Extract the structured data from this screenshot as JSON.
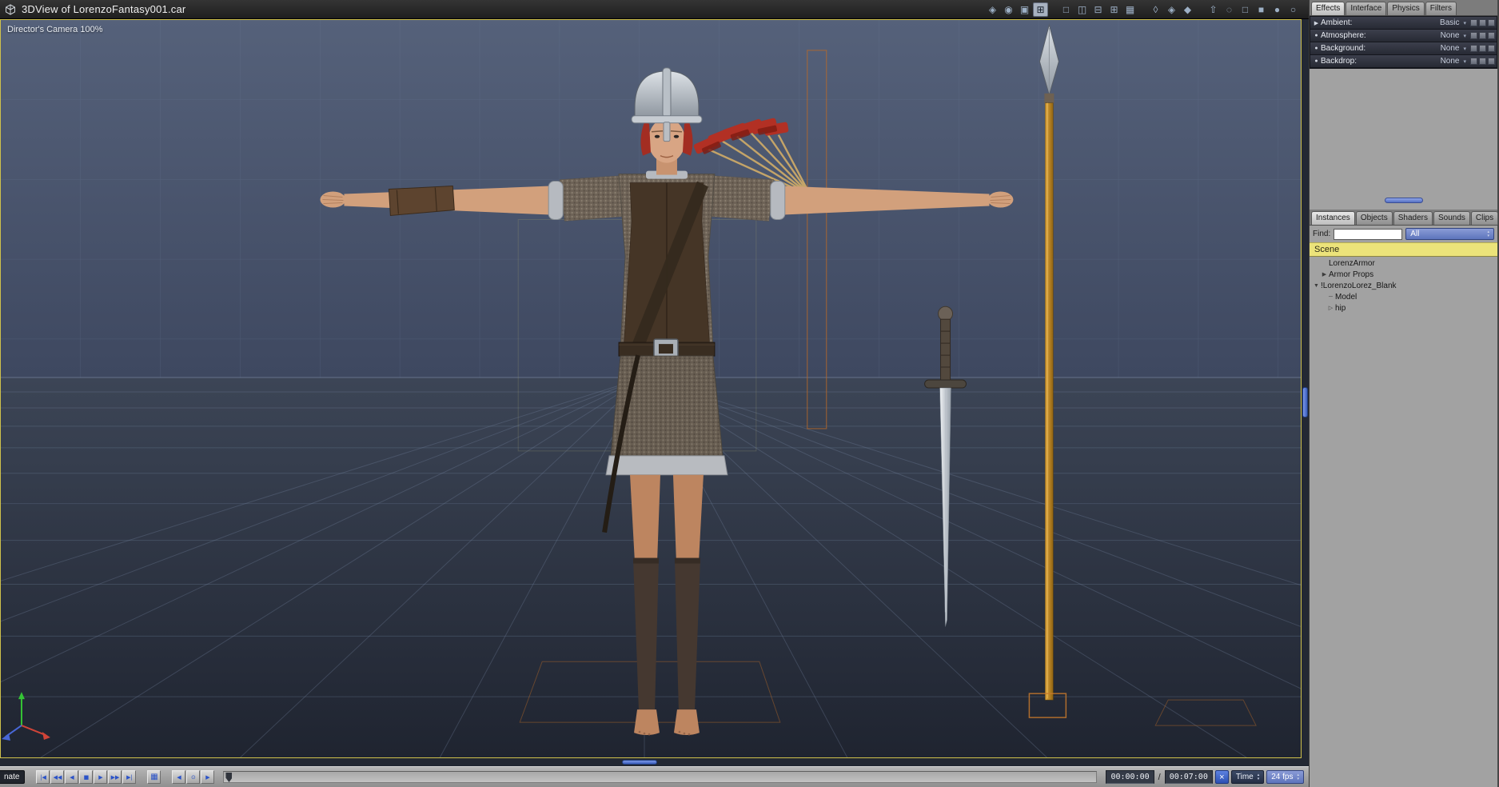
{
  "colors": {
    "accent_blue": "#3a66cc",
    "viewport_background": "#46516a",
    "active_pane_border": "#cfc14b",
    "wireframe_orange": "#b96a28",
    "scene_header_yellow": "#ece37a"
  },
  "window": {
    "title": "3DView of LorenzoFantasy001.car"
  },
  "viewport": {
    "camera_label": "Director's Camera 100%"
  },
  "ui": {
    "chevron_down": "▾",
    "spin_up": "▴",
    "spin_down": "▾"
  },
  "titlebar": {
    "icons": [
      {
        "name": "track-tool-icon",
        "glyph": "◈"
      },
      {
        "name": "eye-icon",
        "glyph": "◉"
      },
      {
        "name": "camera-capture-icon",
        "glyph": "▣"
      },
      {
        "name": "grid-view-icon",
        "glyph": "⊞",
        "cls": "active"
      },
      {
        "name": "layout-single-pane-icon",
        "glyph": "□",
        "cls": "grp"
      },
      {
        "name": "layout-split-vertical-icon",
        "glyph": "◫"
      },
      {
        "name": "layout-split-horizontal-icon",
        "glyph": "⊟"
      },
      {
        "name": "layout-quad-icon",
        "glyph": "⊞"
      },
      {
        "name": "layout-grid-icon",
        "glyph": "▦"
      },
      {
        "name": "shield-low-icon",
        "glyph": "◊",
        "cls": "grp"
      },
      {
        "name": "shield-mid-icon",
        "glyph": "◈"
      },
      {
        "name": "shield-high-icon",
        "glyph": "◆"
      },
      {
        "name": "send-to-icon",
        "glyph": "⇧",
        "cls": "grp"
      },
      {
        "name": "bounding-box-icon",
        "glyph": "◌"
      },
      {
        "name": "wireframe-cube-icon",
        "glyph": "□"
      },
      {
        "name": "solid-cube-icon",
        "glyph": "■"
      },
      {
        "name": "shaded-sphere-icon",
        "glyph": "●"
      },
      {
        "name": "textured-sphere-icon",
        "glyph": "○"
      }
    ]
  },
  "transport": {
    "animate_label": "nate",
    "buttons": [
      {
        "name": "go-to-start-button",
        "glyph": "|◀"
      },
      {
        "name": "rewind-button",
        "glyph": "◀◀"
      },
      {
        "name": "play-reverse-button",
        "glyph": "◀"
      },
      {
        "name": "stop-button",
        "glyph": "■"
      },
      {
        "name": "play-button",
        "glyph": "▶"
      },
      {
        "name": "fast-forward-button",
        "glyph": "▶▶"
      },
      {
        "name": "go-to-end-button",
        "glyph": "▶|"
      }
    ],
    "capture_button": {
      "glyph": "▦"
    },
    "key_buttons": [
      {
        "name": "previous-keyframe-button",
        "glyph": "◀"
      },
      {
        "name": "add-keyframe-button",
        "glyph": "⊙"
      },
      {
        "name": "next-keyframe-button",
        "glyph": "▶"
      }
    ],
    "current_time": "00:00:00",
    "time_separator": "/",
    "end_time": "00:07:00",
    "close_glyph": "×",
    "time_mode_value": "Time",
    "frame_rate_value": "24 fps"
  },
  "effects_panel": {
    "tabs": [
      {
        "name": "tab-effects",
        "label": "Effects",
        "cls": "active"
      },
      {
        "name": "tab-interface",
        "label": "Interface"
      },
      {
        "name": "tab-physics",
        "label": "Physics"
      },
      {
        "name": "tab-filters",
        "label": "Filters"
      }
    ],
    "rows": [
      {
        "name": "property-row-ambient",
        "marker": "▶",
        "label": "Ambient:",
        "value": "Basic"
      },
      {
        "name": "property-row-atmosphere",
        "marker": "●",
        "label": "Atmosphere:",
        "value": "None"
      },
      {
        "name": "property-row-background",
        "marker": "●",
        "label": "Background:",
        "value": "None"
      },
      {
        "name": "property-row-backdrop",
        "marker": "●",
        "label": "Backdrop:",
        "value": "None"
      }
    ]
  },
  "browser_panel": {
    "tabs": [
      {
        "name": "tab-instances",
        "label": "Instances",
        "cls": "active"
      },
      {
        "name": "tab-objects",
        "label": "Objects"
      },
      {
        "name": "tab-shaders",
        "label": "Shaders"
      },
      {
        "name": "tab-sounds",
        "label": "Sounds"
      },
      {
        "name": "tab-clips",
        "label": "Clips"
      }
    ],
    "find_label": "Find:",
    "find_value": "",
    "filter_value": "All",
    "scene_header": "Scene",
    "tree": [
      {
        "name": "tree-item-lorenzarmor",
        "label": "LorenzArmor",
        "marker": "",
        "cls": "ind1"
      },
      {
        "name": "tree-item-armor-props",
        "label": "Armor Props",
        "marker": "▶",
        "cls": "ind1"
      },
      {
        "name": "tree-item-lorenzolorez-blank",
        "label": "!LorenzoLorez_Blank",
        "marker": "▼",
        "cls": "ind0"
      },
      {
        "name": "tree-item-model",
        "label": "Model",
        "marker": "─",
        "cls": "ind2"
      },
      {
        "name": "tree-item-hip",
        "label": "hip",
        "marker": "▷",
        "cls": "ind2"
      }
    ]
  }
}
